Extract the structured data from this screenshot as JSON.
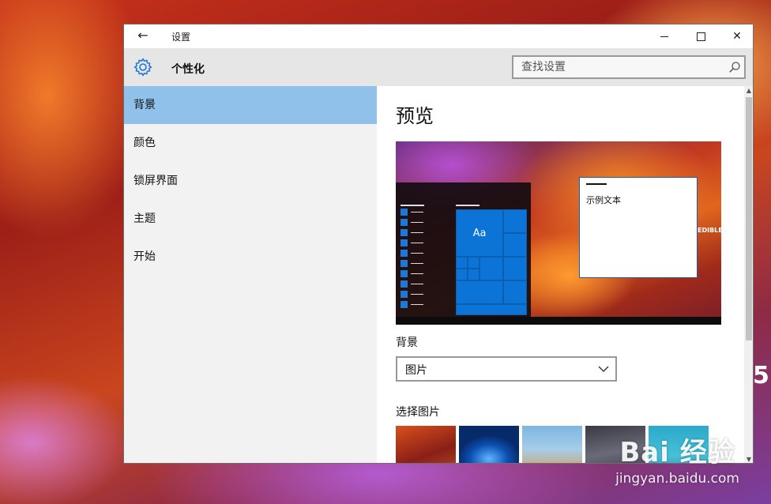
{
  "window": {
    "title": "设置",
    "section_title": "个性化",
    "search_placeholder": "查找设置"
  },
  "sidebar": {
    "items": [
      {
        "label": "背景",
        "active": true
      },
      {
        "label": "颜色",
        "active": false
      },
      {
        "label": "锁屏界面",
        "active": false
      },
      {
        "label": "主题",
        "active": false
      },
      {
        "label": "开始",
        "active": false
      }
    ]
  },
  "main": {
    "preview_heading": "预览",
    "preview_tile_text": "Aa",
    "preview_sample_text": "示例文本",
    "preview_edge_text": "EDIBLE",
    "background_label": "背景",
    "background_value": "图片",
    "choose_picture_label": "选择图片"
  },
  "desktop": {
    "watermark_brand": "Bai 经验",
    "watermark_url": "jingyan.baidu.com"
  },
  "colors": {
    "accent": "#0c74d6",
    "selected_nav": "#8fc1ea"
  }
}
